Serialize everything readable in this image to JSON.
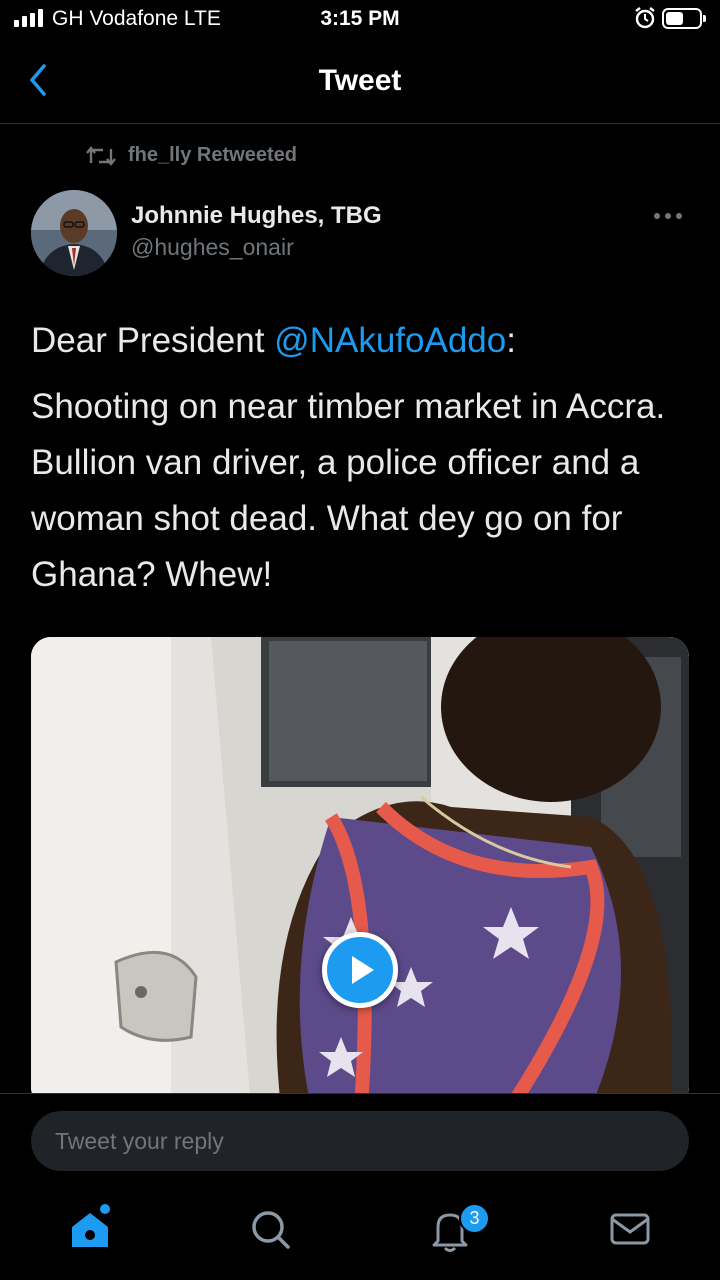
{
  "status_bar": {
    "carrier": "GH Vodafone  LTE",
    "time": "3:15 PM",
    "icons": [
      "signal-icon",
      "alarm-icon",
      "battery-icon"
    ]
  },
  "nav": {
    "title": "Tweet",
    "back_icon": "chevron-left-icon"
  },
  "retweet": {
    "text": "fhe_lly Retweeted",
    "icon": "retweet-icon"
  },
  "author": {
    "name": "Johnnie Hughes, TBG",
    "handle": "@hughes_onair"
  },
  "tweet": {
    "line1_prefix": "Dear President ",
    "mention": "@NAkufoAddo",
    "line1_suffix": ":",
    "paragraph2": "Shooting on near timber market in Accra. Bullion van driver, a police officer and a woman shot dead. What dey go on for Ghana? Whew!"
  },
  "reply": {
    "placeholder": "Tweet your reply"
  },
  "tabbar": {
    "notification_count": "3",
    "icons": [
      "home-icon",
      "search-icon",
      "notifications-icon",
      "messages-icon"
    ]
  },
  "colors": {
    "accent": "#1d9bf0",
    "background": "#000000",
    "secondary_text": "#71767b"
  }
}
